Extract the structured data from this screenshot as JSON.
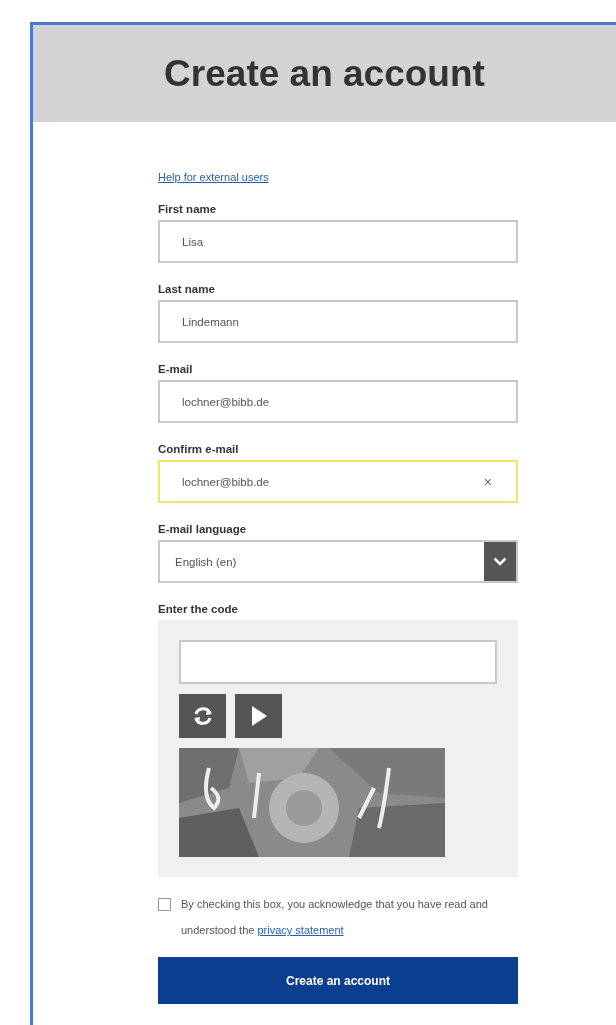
{
  "header": {
    "title": "Create an account"
  },
  "help_link": "Help for external users",
  "fields": [
    {
      "kind": "text",
      "label": "First name",
      "value": "Lisa",
      "focused": false
    },
    {
      "kind": "text",
      "label": "Last name",
      "value": "Lindemann",
      "focused": false
    },
    {
      "kind": "text",
      "label": "E-mail",
      "value": "lochner@bibb.de",
      "focused": false
    },
    {
      "kind": "text",
      "label": "Confirm e-mail",
      "value": "lochner@bibb.de",
      "focused": true,
      "clear": "×"
    },
    {
      "kind": "select",
      "label": "E-mail language",
      "value": "English (en)",
      "focused": false
    }
  ],
  "captcha": {
    "label": "Enter the code"
  },
  "consent": {
    "checked": false,
    "text": "By checking this box, you acknowledge that you have read and understood the",
    "link": "privacy statement"
  },
  "submit": "Create an account"
}
